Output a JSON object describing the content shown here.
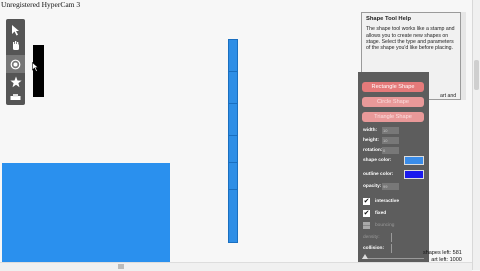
{
  "watermark": "Unregistered HyperCam 3",
  "toolbar": {
    "tools": [
      {
        "name": "arrow-tool",
        "icon": "cursor-arrow-icon",
        "selected": false
      },
      {
        "name": "hand-tool",
        "icon": "hand-icon",
        "selected": false
      },
      {
        "name": "shape-tool",
        "icon": "target-circle-icon",
        "selected": true
      },
      {
        "name": "star-tool",
        "icon": "star-icon",
        "selected": false
      },
      {
        "name": "stamp-tool",
        "icon": "stamp-icon",
        "selected": false
      }
    ]
  },
  "help": {
    "title": "Shape Tool Help",
    "body": "The shape tool works like a stamp and allows you to create new shapes on stage.  Select the type and parameters of the shape you'd like before placing.",
    "more": "art and"
  },
  "panel": {
    "buttons": {
      "rectangle": "Rectangle Shape",
      "circle": "Circle Shape",
      "triangle": "Triangle Shape"
    },
    "fields": {
      "width_label": "width:",
      "width_value": "10",
      "height_label": "height:",
      "height_value": "10",
      "rotation_label": "rotation:",
      "rotation_value": "0",
      "shape_color_label": "shape color:",
      "outline_color_label": "outline color:",
      "opacity_label": "opacity:",
      "opacity_value": "99"
    },
    "checks": {
      "interactive_label": "interactive",
      "interactive_checked": true,
      "fixed_label": "fixed",
      "fixed_checked": true,
      "bouncing_label": "bouncing",
      "bouncing_checked": false
    },
    "density_label": "density:",
    "collision_label": "collision:",
    "colors": {
      "shape": "#3a8ce8",
      "outline": "#1a1aee"
    }
  },
  "status": {
    "shapes_left": "shapes left: 581",
    "art_left": "art left: 1000"
  }
}
